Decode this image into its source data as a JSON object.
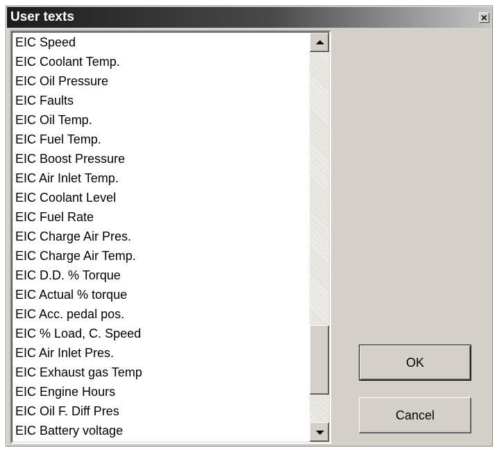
{
  "window": {
    "title": "User texts",
    "close_icon": "close-x-icon"
  },
  "list": {
    "items": [
      "EIC Speed",
      "EIC Coolant Temp.",
      "EIC Oil Pressure",
      "EIC Faults",
      "EIC Oil Temp.",
      "EIC Fuel Temp.",
      "EIC Boost Pressure",
      "EIC Air Inlet Temp.",
      "EIC Coolant Level",
      "EIC Fuel Rate",
      "EIC Charge Air Pres.",
      "EIC Charge Air Temp.",
      "EIC D.D. % Torque",
      "EIC Actual % torque",
      "EIC Acc. pedal pos.",
      "EIC % Load, C. Speed",
      "EIC Air Inlet Pres.",
      "EIC Exhaust gas Temp",
      "EIC Engine Hours",
      "EIC Oil F. Diff Pres",
      "EIC Battery voltage"
    ],
    "scroll_up_icon": "scroll-up-arrow-icon",
    "scroll_down_icon": "scroll-down-arrow-icon"
  },
  "buttons": {
    "ok_label": "OK",
    "cancel_label": "Cancel"
  }
}
